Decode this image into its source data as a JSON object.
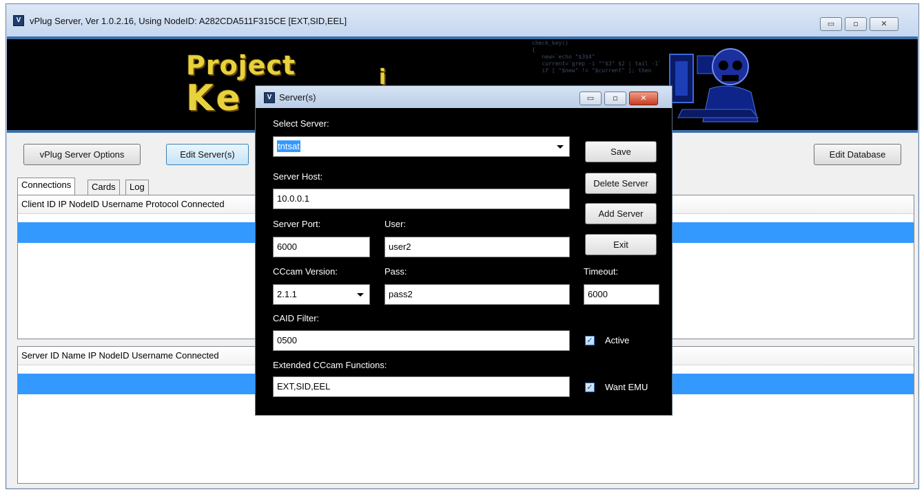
{
  "app": {
    "title": "vPlug Server,  Ver 1.0.2.16, Using NodeID: A282CDA511F315CE [EXT,SID,EEL]",
    "icon": "vplug-app-icon",
    "window_buttons": {
      "minimize": "▭",
      "maximize": "▫",
      "close": "✕"
    }
  },
  "banner": {
    "logo_line1": "Project",
    "logo_line2": "Ke",
    "logo_tail": "i",
    "code": "check_key()\n{\n   new=`echo \"$3$4\"\n   current=`grep -i \"^$3\" $2 | tail -1`\n   if [ \"$new\" != \"$current\" ]; then",
    "icon": "skull-hacker-icon"
  },
  "toolbar": {
    "options_label": "vPlug Server Options",
    "edit_servers_label": "Edit Server(s)",
    "edit_database_label": "Edit Database"
  },
  "tabs": [
    {
      "label": "Connections"
    },
    {
      "label": "Cards"
    },
    {
      "label": "Log"
    }
  ],
  "connections_table": {
    "header": "Client ID  IP  NodeID  Username  Protocol  Connected"
  },
  "servers_table": {
    "header": "Server ID  Name  IP  NodeID  Username  Connected"
  },
  "dialog": {
    "title": "Server(s)",
    "select_server_label": "Select Server:",
    "select_server_value": "tntsat",
    "server_host_label": "Server Host:",
    "server_host_value": "10.0.0.1",
    "server_port_label": "Server Port:",
    "server_port_value": "6000",
    "user_label": "User:",
    "user_value": "user2",
    "cccam_version_label": "CCcam Version:",
    "cccam_version_value": "2.1.1",
    "pass_label": "Pass:",
    "pass_value": "pass2",
    "timeout_label": "Timeout:",
    "timeout_value": "6000",
    "caid_filter_label": "CAID Filter:",
    "caid_filter_value": "0500",
    "extended_label": "Extended CCcam Functions:",
    "extended_value": "EXT,SID,EEL",
    "active_label": "Active",
    "active_checked": true,
    "want_emu_label": "Want EMU",
    "want_emu_checked": true,
    "buttons": {
      "save": "Save",
      "delete": "Delete Server",
      "add": "Add Server",
      "exit": "Exit"
    }
  }
}
